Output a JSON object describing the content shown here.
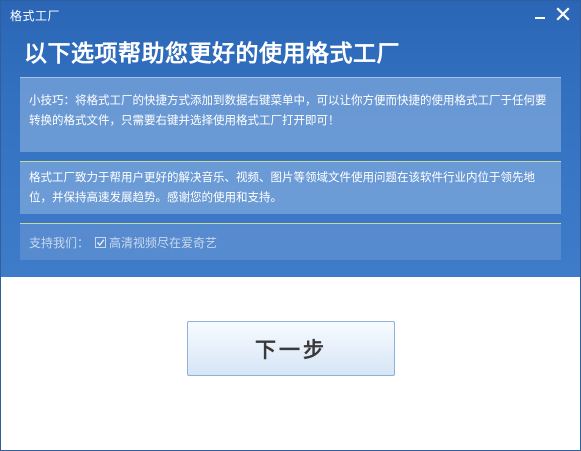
{
  "window": {
    "title": "格式工厂",
    "minimize_icon": "minimize-icon",
    "close_icon": "close-icon"
  },
  "heading": "以下选项帮助您更好的使用格式工厂",
  "tip": {
    "text": "小技巧：将格式工厂的快捷方式添加到数据右键菜单中，可以让你方便而快捷的使用格式工厂于任何要转换的格式文件，只需要右键并选择使用格式工厂打开即可！"
  },
  "about": {
    "text": "格式工厂致力于帮用户更好的解决音乐、视频、图片等领域文件使用问题在该软件行业内位于领先地位，并保持高速发展趋势。感谢您的使用和支持。"
  },
  "support": {
    "label": "支持我们：",
    "option_label": "高清视频尽在爱奇艺",
    "option_checked": true
  },
  "next_button": {
    "label": "下一步"
  },
  "colors": {
    "header_blue": "#3370c0",
    "panel": "#96b9e4",
    "button_bg": "#e7f0fb"
  }
}
